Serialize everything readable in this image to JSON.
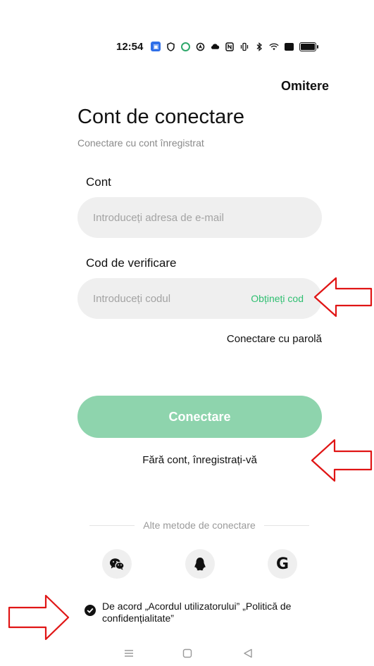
{
  "status_bar": {
    "time": "12:54",
    "icons": [
      "app-icon",
      "shield-icon",
      "ring-icon",
      "nav-icon",
      "cloud-icon",
      "nfc-icon",
      "vibrate-icon",
      "bluetooth-icon",
      "wifi-icon",
      "box-icon",
      "battery-icon"
    ]
  },
  "header": {
    "skip_label": "Omitere"
  },
  "page": {
    "title": "Cont de conectare",
    "subtitle": "Conectare cu cont înregistrat"
  },
  "account": {
    "label": "Cont",
    "placeholder": "Introduceți adresa de e-mail",
    "value": ""
  },
  "code": {
    "label": "Cod de verificare",
    "placeholder": "Introduceți codul",
    "value": "",
    "get_code_label": "Obțineți cod"
  },
  "password_login_label": "Conectare cu parolă",
  "login_button_label": "Conectare",
  "register_label": "Fără cont, înregistrați-vă",
  "other_methods_label": "Alte metode de conectare",
  "social": {
    "wechat_icon": "wechat-icon",
    "qq_icon": "qq-icon",
    "google_letter": "G"
  },
  "agreement": {
    "text": "De acord „Acordul utilizatorului” „Politică de confidențialitate”",
    "checked": true
  },
  "nav_bar": {
    "menu": "☰",
    "home": "▢",
    "back": "◁"
  },
  "colors": {
    "accent_green": "#2fbf71",
    "button_green": "#8ed4ad",
    "field_bg": "#efefef",
    "annotation_red": "#e01515"
  }
}
